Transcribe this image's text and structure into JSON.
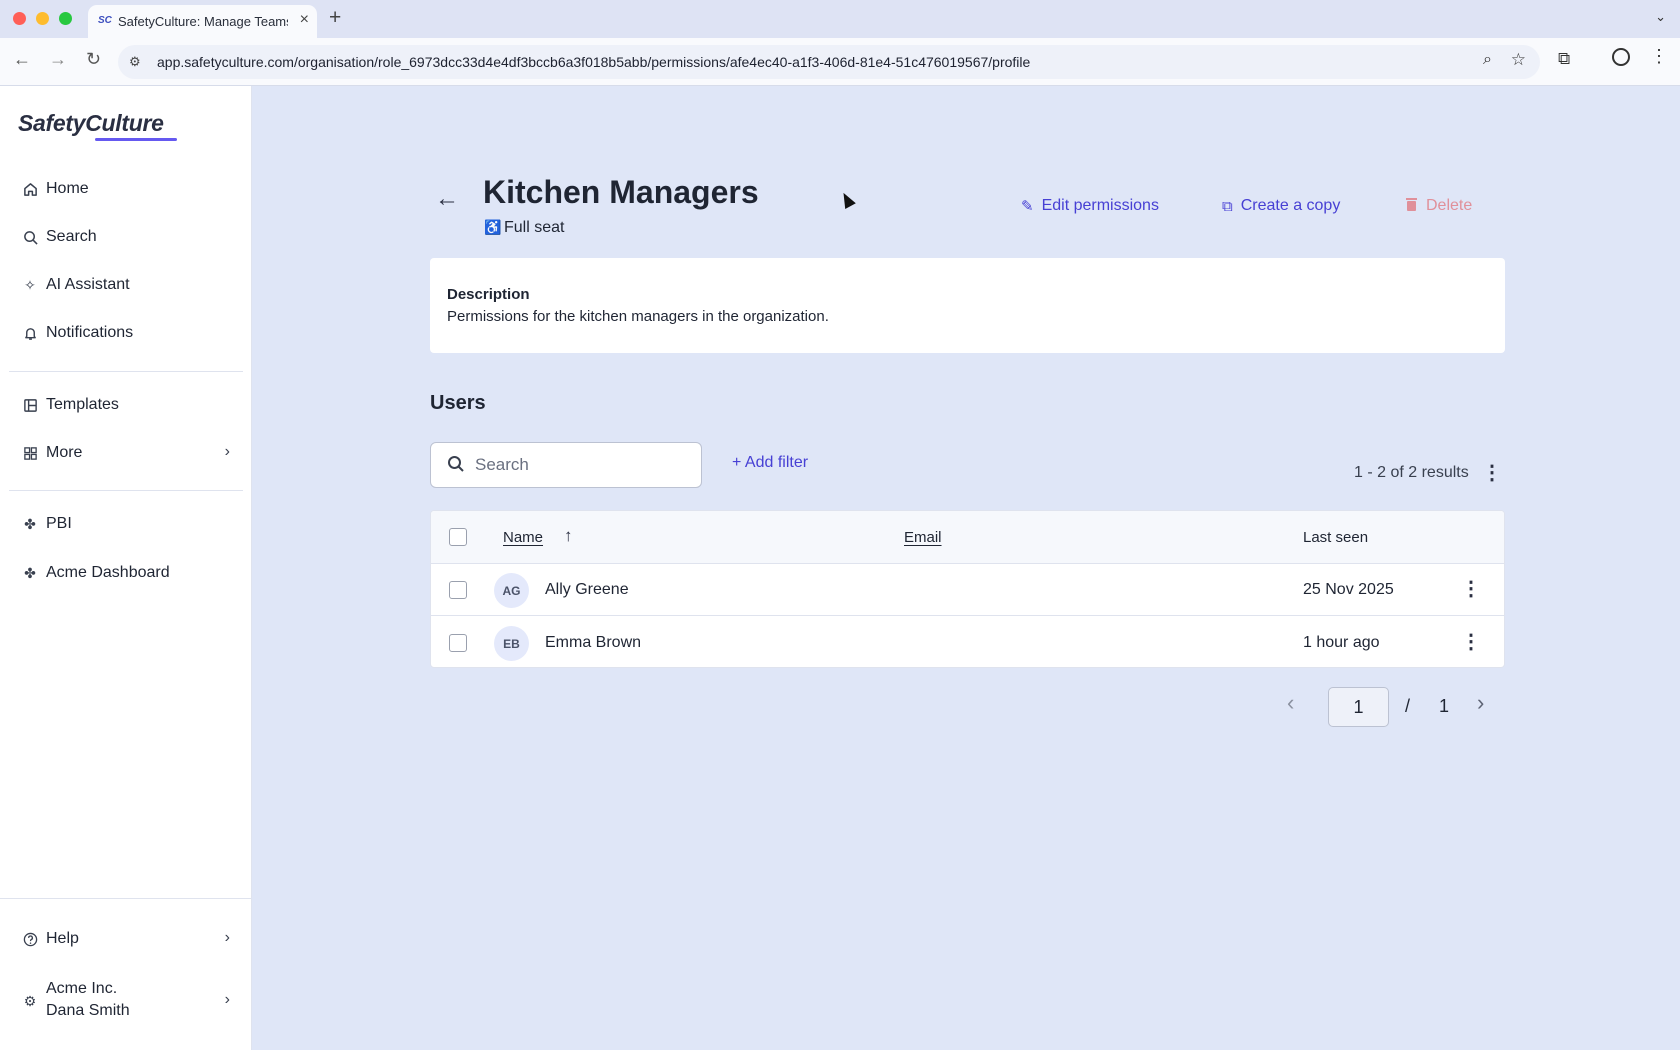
{
  "browser": {
    "tab_title": "SafetyCulture: Manage Teams",
    "tab_favicon": "SC",
    "url": "app.safetyculture.com/organisation/role_6973dcc33d4e4df3bccb6a3f018b5abb/permissions/afe4ec40-a1f3-406d-81e4-51c476019567/profile"
  },
  "sidebar": {
    "logo": "SafetyCulture",
    "items": [
      {
        "label": "Home",
        "icon": "home-icon"
      },
      {
        "label": "Search",
        "icon": "search-icon"
      },
      {
        "label": "AI Assistant",
        "icon": "sparkle-icon"
      },
      {
        "label": "Notifications",
        "icon": "bell-icon"
      },
      {
        "label": "Templates",
        "icon": "templates-icon"
      },
      {
        "label": "More",
        "icon": "grid-icon"
      },
      {
        "label": "PBI",
        "icon": "puzzle-icon"
      },
      {
        "label": "Acme Dashboard",
        "icon": "puzzle-icon"
      }
    ],
    "help": "Help",
    "org_name": "Acme Inc.",
    "user_name": "Dana Smith"
  },
  "header": {
    "title": "Kitchen Managers",
    "seat": "Full seat",
    "actions": {
      "edit": "Edit permissions",
      "copy": "Create a copy",
      "delete": "Delete"
    }
  },
  "description": {
    "label": "Description",
    "text": "Permissions for the kitchen managers in the organization."
  },
  "users": {
    "heading": "Users",
    "search_placeholder": "Search",
    "add_filter": "+ Add filter",
    "results": "1 - 2 of 2 results",
    "columns": {
      "name": "Name",
      "email": "Email",
      "last_seen": "Last seen"
    },
    "rows": [
      {
        "initials": "AG",
        "name": "Ally Greene",
        "email": "",
        "last_seen": "25 Nov 2025"
      },
      {
        "initials": "EB",
        "name": "Emma Brown",
        "email": "",
        "last_seen": "1 hour ago"
      }
    ]
  },
  "pagination": {
    "current": "1",
    "separator": "/",
    "total": "1"
  },
  "colors": {
    "accent": "#4740d4",
    "delete": "#e0909a",
    "background": "#dfe6f7"
  }
}
